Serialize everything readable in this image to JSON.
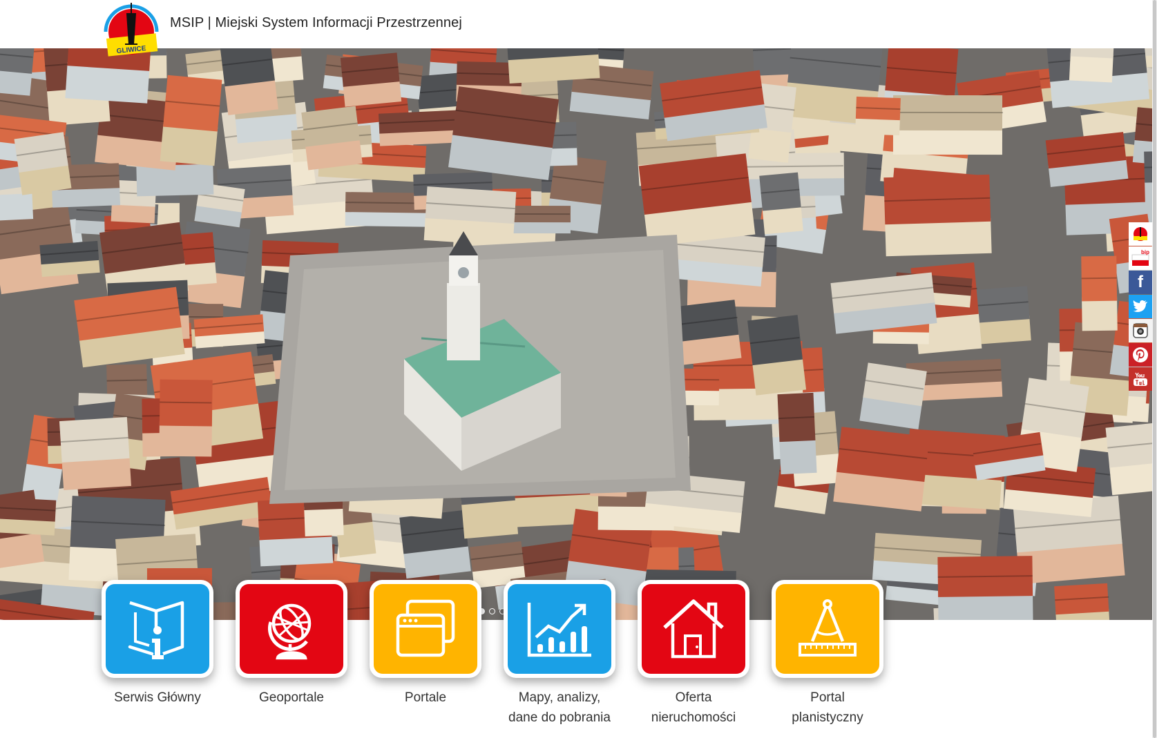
{
  "header": {
    "title": "MSIP | Miejski System Informacji Przestrzennej",
    "logo_text": "GLIWICE"
  },
  "carousel": {
    "slides": 3,
    "active": 0
  },
  "social": [
    {
      "name": "gliwice",
      "icon": "gliwice-logo-icon",
      "color": "#ffffff"
    },
    {
      "name": "bip",
      "icon": "bip-icon",
      "color": "#ffffff"
    },
    {
      "name": "facebook",
      "icon": "facebook-icon",
      "color": "#3b5998"
    },
    {
      "name": "twitter",
      "icon": "twitter-icon",
      "color": "#1da1f2"
    },
    {
      "name": "instagram",
      "icon": "instagram-icon",
      "color": "#ffffff"
    },
    {
      "name": "pinterest",
      "icon": "pinterest-icon",
      "color": "#cb2027"
    },
    {
      "name": "youtube",
      "icon": "youtube-icon",
      "color": "#c4302b"
    }
  ],
  "tiles": [
    {
      "label_1": "Serwis Główny",
      "label_2": "",
      "color": "#1aa0e6",
      "icon": "info-book-icon"
    },
    {
      "label_1": "Geoportale",
      "label_2": "",
      "color": "#e30613",
      "icon": "globe-icon"
    },
    {
      "label_1": "Portale",
      "label_2": "",
      "color": "#ffb400",
      "icon": "windows-icon"
    },
    {
      "label_1": "Mapy, analizy,",
      "label_2": "dane do pobrania",
      "color": "#1aa0e6",
      "icon": "chart-icon"
    },
    {
      "label_1": "Oferta",
      "label_2": "nieruchomości",
      "color": "#e30613",
      "icon": "house-icon"
    },
    {
      "label_1": "Portal",
      "label_2": "planistyczny",
      "color": "#ffb400",
      "icon": "compass-ruler-icon"
    }
  ]
}
